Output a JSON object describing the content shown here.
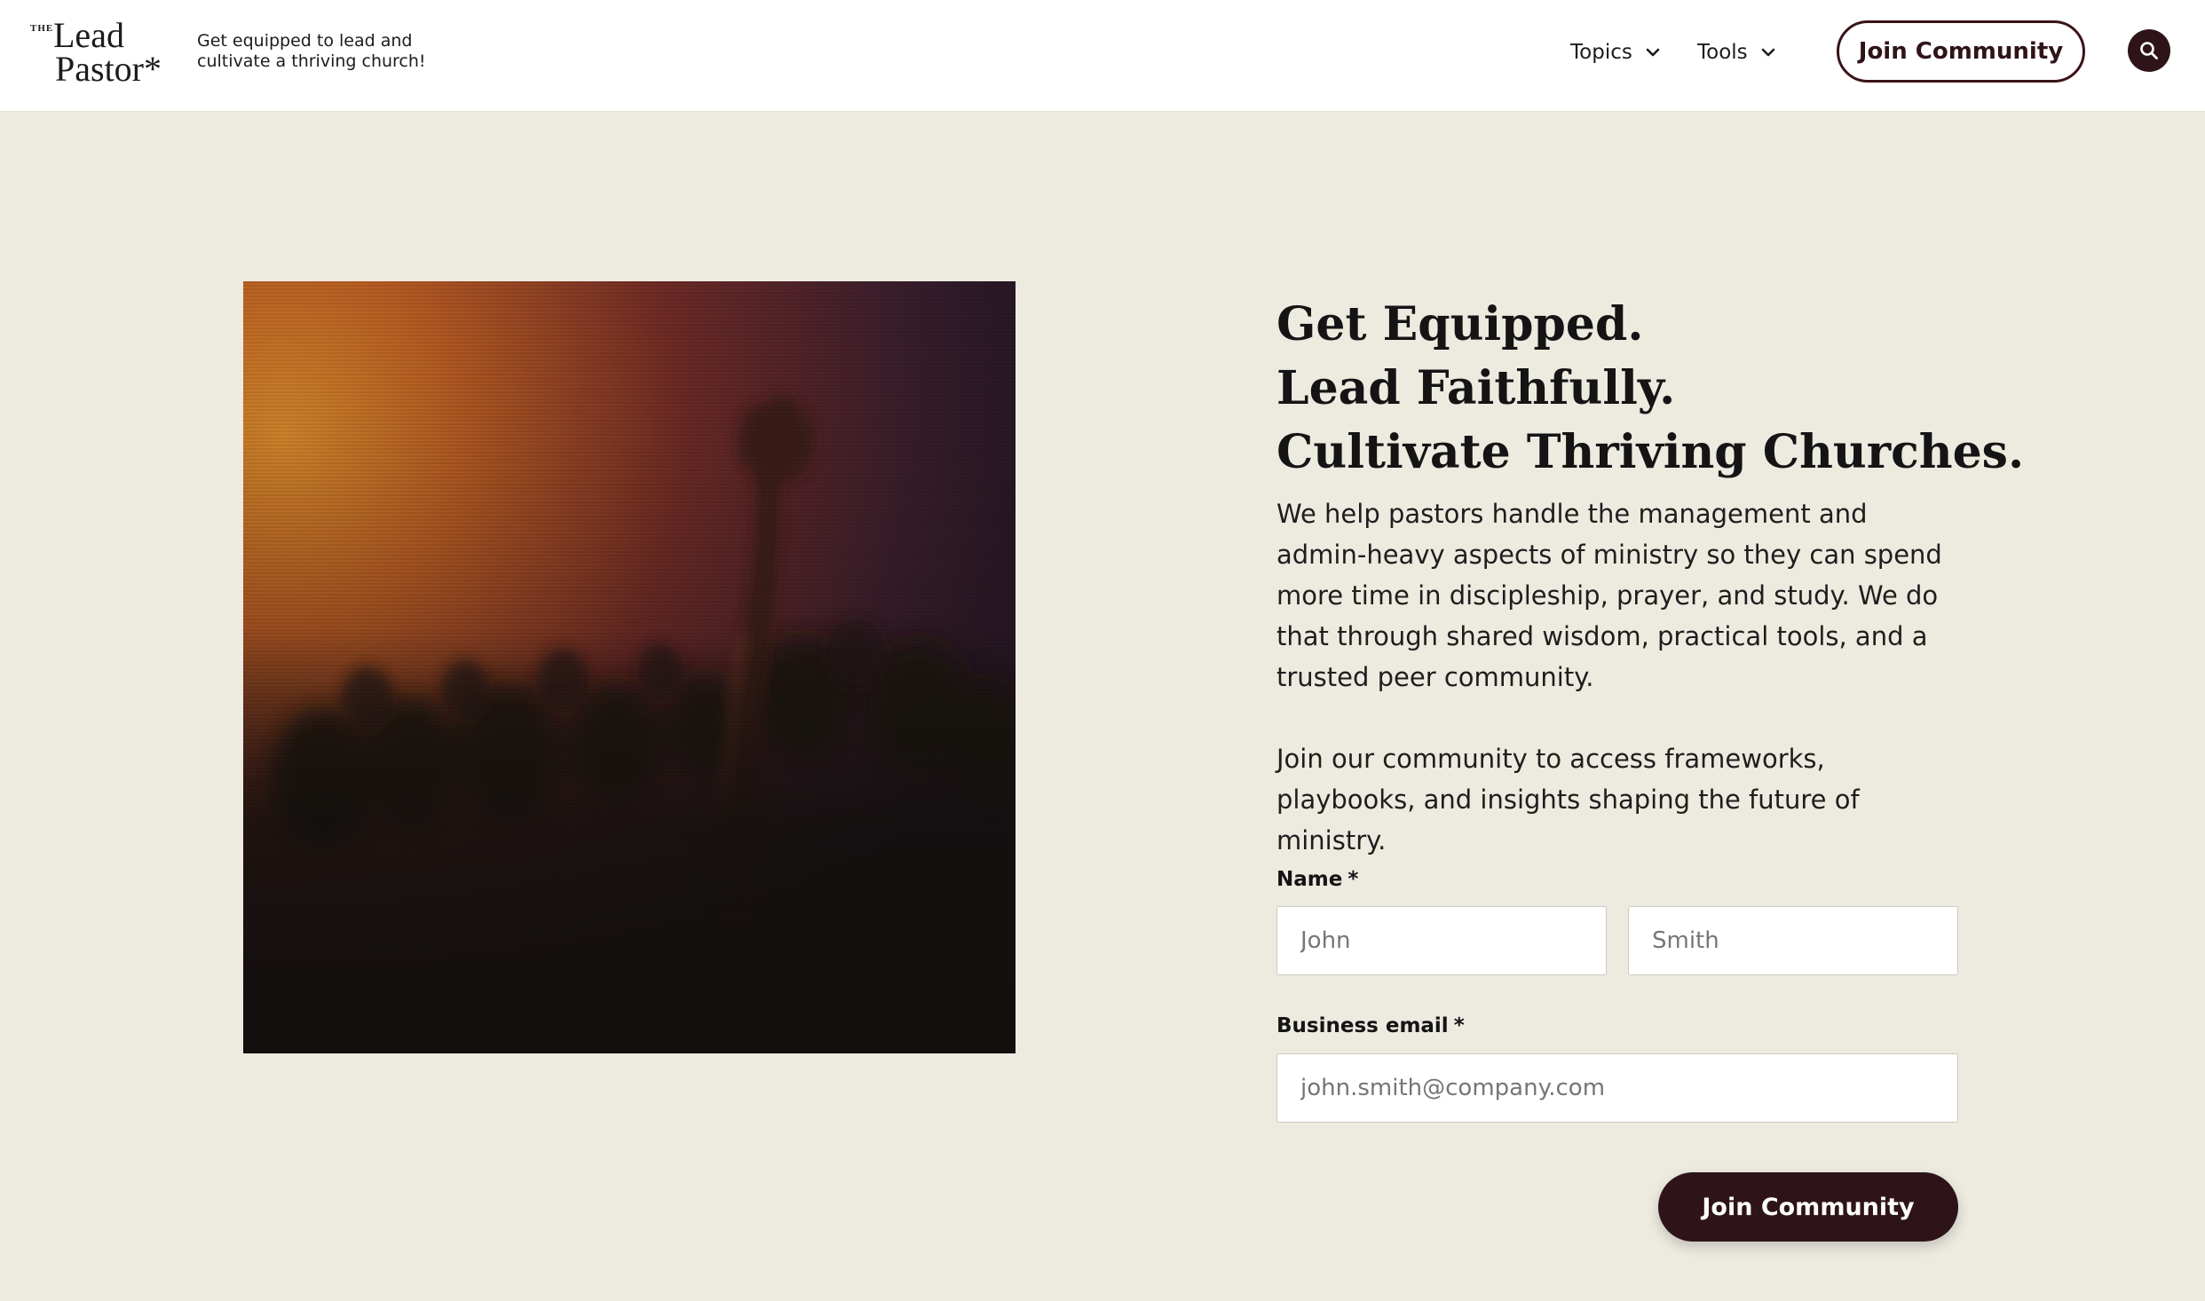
{
  "header": {
    "logo": {
      "the": "THE",
      "lead": "Lead",
      "pastor": "Pastor*"
    },
    "tagline": "Get equipped to lead and cultivate a thriving church!",
    "nav": [
      {
        "label": "Topics",
        "icon": "chevron-down-icon"
      },
      {
        "label": "Tools",
        "icon": "chevron-down-icon"
      }
    ],
    "join_button": "Join Community",
    "search_icon": "search-icon"
  },
  "hero": {
    "image_alt": "Worship crowd with raised hand",
    "headline": [
      "Get Equipped.",
      "Lead Faithfully.",
      "Cultivate Thriving Churches."
    ],
    "paragraph1": "We help pastors handle the management and admin-heavy aspects of ministry so they can spend more time in discipleship, prayer, and study. We do that through shared wisdom, practical tools, and a trusted peer community.",
    "paragraph2": "Join our community to access frameworks, playbooks, and insights shaping the future of ministry."
  },
  "form": {
    "name_label": "Name",
    "email_label": "Business email",
    "required_mark": "*",
    "first_name_placeholder": "John",
    "last_name_placeholder": "Smith",
    "email_placeholder": "john.smith@company.com",
    "submit_label": "Join Community"
  },
  "colors": {
    "background": "#edeae0",
    "header_bg": "#ffffff",
    "brand_dark": "#2e1418",
    "text": "#141414"
  }
}
